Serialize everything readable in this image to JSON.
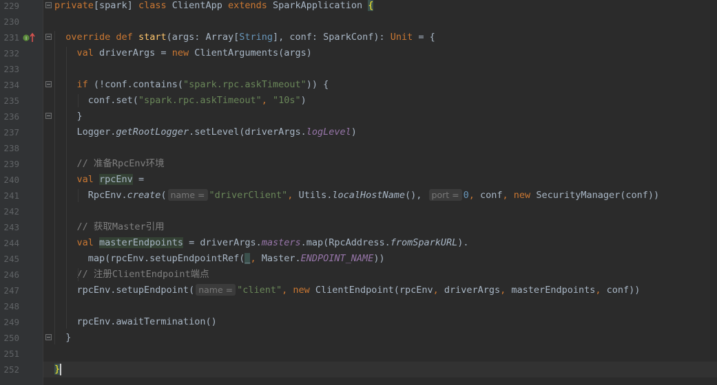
{
  "editor": {
    "language": "scala",
    "theme_colors": {
      "background": "#2b2b2b",
      "keyword": "#cc7832",
      "string": "#6a8759",
      "number": "#6897bb",
      "comment": "#808080",
      "method": "#ffc66d",
      "field": "#9876aa"
    },
    "gutter_icons": {
      "line_231": [
        "implements-icon",
        "overrides-up-arrow-icon"
      ]
    },
    "lines": [
      {
        "num": "229",
        "tokens": [
          [
            "k",
            "private"
          ],
          [
            "t",
            "[spark] "
          ],
          [
            "k",
            "class "
          ],
          [
            "t",
            "ClientApp "
          ],
          [
            "k",
            "extends "
          ],
          [
            "t",
            "SparkApplication "
          ],
          [
            "bm",
            "{"
          ]
        ]
      },
      {
        "num": "230",
        "tokens": []
      },
      {
        "num": "231",
        "tokens": [
          [
            "t",
            "  "
          ],
          [
            "k",
            "override def "
          ],
          [
            "f",
            "start"
          ],
          [
            "t",
            "(args: Array["
          ],
          [
            "n",
            "String"
          ],
          [
            "t",
            "], conf: SparkConf): "
          ],
          [
            "k",
            "Unit"
          ],
          [
            "t",
            " = {"
          ]
        ]
      },
      {
        "num": "232",
        "tokens": [
          [
            "t",
            "    "
          ],
          [
            "k",
            "val "
          ],
          [
            "t",
            "driverArgs = "
          ],
          [
            "k",
            "new "
          ],
          [
            "t",
            "ClientArguments(args)"
          ]
        ]
      },
      {
        "num": "233",
        "tokens": []
      },
      {
        "num": "234",
        "tokens": [
          [
            "t",
            "    "
          ],
          [
            "k",
            "if "
          ],
          [
            "t",
            "(!conf.contains("
          ],
          [
            "s",
            "\"spark.rpc.askTimeout\""
          ],
          [
            "t",
            ")) {"
          ]
        ]
      },
      {
        "num": "235",
        "tokens": [
          [
            "t",
            "      conf.set("
          ],
          [
            "s",
            "\"spark.rpc.askTimeout\""
          ],
          [
            "k",
            ", "
          ],
          [
            "s",
            "\"10s\""
          ],
          [
            "t",
            ")"
          ]
        ]
      },
      {
        "num": "236",
        "tokens": [
          [
            "t",
            "    }"
          ]
        ]
      },
      {
        "num": "237",
        "tokens": [
          [
            "t",
            "    Logger."
          ],
          [
            "i",
            "getRootLogger"
          ],
          [
            "t",
            ".setLevel(driverArgs."
          ],
          [
            "p",
            "logLevel"
          ],
          [
            "t",
            ")"
          ]
        ]
      },
      {
        "num": "238",
        "tokens": []
      },
      {
        "num": "239",
        "tokens": [
          [
            "t",
            "    "
          ],
          [
            "c",
            "// 准备RpcEnv环境"
          ]
        ]
      },
      {
        "num": "240",
        "tokens": [
          [
            "t",
            "    "
          ],
          [
            "k",
            "val "
          ],
          [
            "hv",
            "rpcEnv"
          ],
          [
            "t",
            " ="
          ]
        ]
      },
      {
        "num": "241",
        "tokens": [
          [
            "t",
            "      RpcEnv."
          ],
          [
            "i",
            "create"
          ],
          [
            "t",
            "("
          ],
          [
            "hint",
            "name ="
          ],
          [
            "s",
            "\"driverClient\""
          ],
          [
            "k",
            ", "
          ],
          [
            "t",
            "Utils."
          ],
          [
            "i",
            "localHostName"
          ],
          [
            "t",
            "(), "
          ],
          [
            "hint",
            "port ="
          ],
          [
            "n",
            "0"
          ],
          [
            "k",
            ", "
          ],
          [
            "t",
            "conf"
          ],
          [
            "k",
            ", new "
          ],
          [
            "t",
            "SecurityManager(conf))"
          ]
        ]
      },
      {
        "num": "242",
        "tokens": []
      },
      {
        "num": "243",
        "tokens": [
          [
            "t",
            "    "
          ],
          [
            "c",
            "// 获取Master引用"
          ]
        ]
      },
      {
        "num": "244",
        "tokens": [
          [
            "t",
            "    "
          ],
          [
            "k",
            "val "
          ],
          [
            "hv",
            "masterEndpoints"
          ],
          [
            "t",
            " = driverArgs."
          ],
          [
            "p",
            "masters"
          ],
          [
            "t",
            ".map(RpcAddress."
          ],
          [
            "i",
            "fromSparkURL"
          ],
          [
            "t",
            ")."
          ]
        ]
      },
      {
        "num": "245",
        "tokens": [
          [
            "t",
            "      map(rpcEnv.setupEndpointRef("
          ],
          [
            "hu",
            "_"
          ],
          [
            "k",
            ", "
          ],
          [
            "t",
            "Master."
          ],
          [
            "p",
            "ENDPOINT_NAME"
          ],
          [
            "t",
            "))"
          ]
        ]
      },
      {
        "num": "246",
        "tokens": [
          [
            "t",
            "    "
          ],
          [
            "c",
            "// 注册ClientEndpoint端点"
          ]
        ]
      },
      {
        "num": "247",
        "tokens": [
          [
            "t",
            "    rpcEnv.setupEndpoint("
          ],
          [
            "hint",
            "name ="
          ],
          [
            "s",
            "\"client\""
          ],
          [
            "k",
            ", new "
          ],
          [
            "t",
            "ClientEndpoint(rpcEnv"
          ],
          [
            "k",
            ", "
          ],
          [
            "t",
            "driverArgs"
          ],
          [
            "k",
            ", "
          ],
          [
            "t",
            "masterEndpoints"
          ],
          [
            "k",
            ", "
          ],
          [
            "t",
            "conf))"
          ]
        ]
      },
      {
        "num": "248",
        "tokens": []
      },
      {
        "num": "249",
        "tokens": [
          [
            "t",
            "    rpcEnv.awaitTermination()"
          ]
        ]
      },
      {
        "num": "250",
        "tokens": [
          [
            "t",
            "  }"
          ]
        ]
      },
      {
        "num": "251",
        "tokens": []
      },
      {
        "num": "252",
        "tokens": [
          [
            "bm",
            "}"
          ],
          [
            "caret",
            ""
          ]
        ]
      }
    ]
  }
}
